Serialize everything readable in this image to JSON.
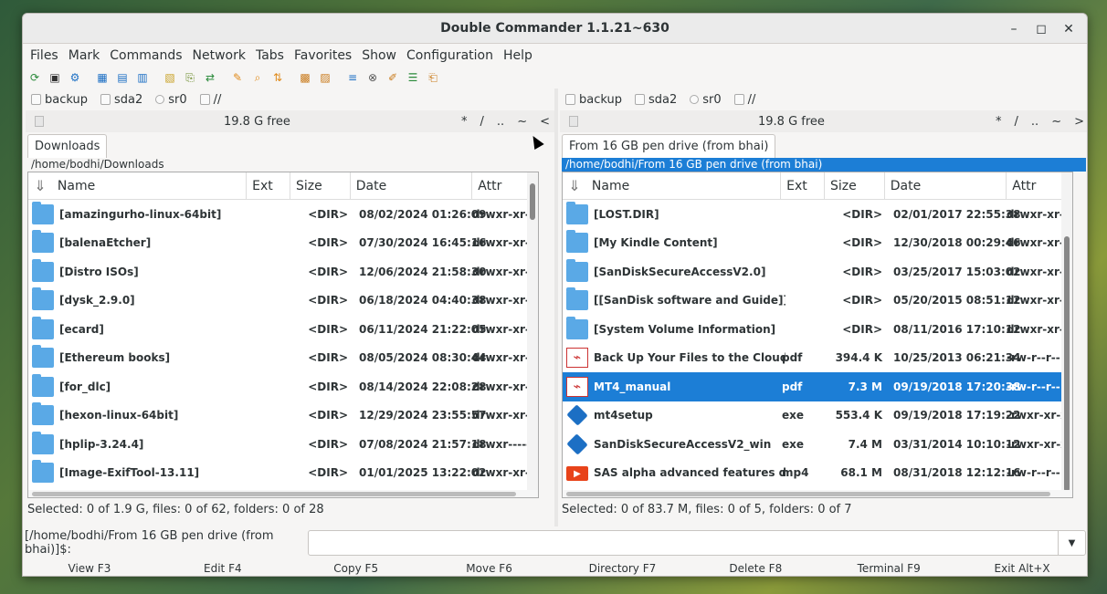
{
  "window": {
    "title": "Double Commander 1.1.21~630"
  },
  "menus": [
    "Files",
    "Mark",
    "Commands",
    "Network",
    "Tabs",
    "Favorites",
    "Show",
    "Configuration",
    "Help"
  ],
  "toolbar_icons": [
    "refresh-icon",
    "terminal-icon",
    "settings-icon",
    "brief-view-icon",
    "full-view-icon",
    "columns-view-icon",
    "thumbnails-view-icon",
    "copy-path-icon",
    "swap-panels-icon",
    "multi-rename-icon",
    "search-icon",
    "sync-dirs-icon",
    "pack-icon",
    "unpack-icon",
    "compare-icon",
    "binoculars-icon",
    "edit-icon",
    "notes-icon",
    "clipboard-icon"
  ],
  "drives": [
    "backup",
    "sda2",
    "sr0",
    "//"
  ],
  "left_panel": {
    "free": "19.8 G free",
    "nav": [
      "*",
      "/",
      "..",
      "~",
      "<"
    ],
    "tab": "Downloads",
    "path": "/home/bodhi/Downloads",
    "columns": [
      "Name",
      "Ext",
      "Size",
      "Date",
      "Attr"
    ],
    "rows": [
      {
        "name": "[amazingurho-linux-64bit]",
        "ext": "",
        "size": "<DIR>",
        "date": "08/02/2024 01:26:09",
        "attr": "drwxr-xr-x",
        "icon": "folder"
      },
      {
        "name": "[balenaEtcher]",
        "ext": "",
        "size": "<DIR>",
        "date": "07/30/2024 16:45:16",
        "attr": "drwxr-xr-x",
        "icon": "folder"
      },
      {
        "name": "[Distro ISOs]",
        "ext": "",
        "size": "<DIR>",
        "date": "12/06/2024 21:58:30",
        "attr": "drwxr-xr-x",
        "icon": "folder"
      },
      {
        "name": "[dysk_2.9.0]",
        "ext": "",
        "size": "<DIR>",
        "date": "06/18/2024 04:40:38",
        "attr": "drwxr-xr-x",
        "icon": "folder"
      },
      {
        "name": "[ecard]",
        "ext": "",
        "size": "<DIR>",
        "date": "06/11/2024 21:22:05",
        "attr": "drwxr-xr-x",
        "icon": "folder"
      },
      {
        "name": "[Ethereum books]",
        "ext": "",
        "size": "<DIR>",
        "date": "08/05/2024 08:30:44",
        "attr": "drwxr-xr-x",
        "icon": "folder"
      },
      {
        "name": "[for_dlc]",
        "ext": "",
        "size": "<DIR>",
        "date": "08/14/2024 22:08:28",
        "attr": "drwxr-xr-x",
        "icon": "folder"
      },
      {
        "name": "[hexon-linux-64bit]",
        "ext": "",
        "size": "<DIR>",
        "date": "12/29/2024 23:55:57",
        "attr": "drwxr-xr-x",
        "icon": "folder"
      },
      {
        "name": "[hplip-3.24.4]",
        "ext": "",
        "size": "<DIR>",
        "date": "07/08/2024 21:57:18",
        "attr": "drwxr-----",
        "icon": "folder"
      },
      {
        "name": "[Image-ExifTool-13.11]",
        "ext": "",
        "size": "<DIR>",
        "date": "01/01/2025 13:22:02",
        "attr": "drwxr-xr-x",
        "icon": "folder"
      }
    ],
    "status": "Selected: 0 of 1.9 G, files: 0 of 62, folders: 0 of 28"
  },
  "right_panel": {
    "free": "19.8 G free",
    "nav": [
      "*",
      "/",
      "..",
      "~",
      ">"
    ],
    "tab": "From 16 GB pen drive (from bhai)",
    "path": "/home/bodhi/From 16 GB pen drive (from bhai)",
    "columns": [
      "Name",
      "Ext",
      "Size",
      "Date",
      "Attr"
    ],
    "rows": [
      {
        "name": "[LOST.DIR]",
        "ext": "",
        "size": "<DIR>",
        "date": "02/01/2017 22:55:38",
        "attr": "drwxr-xr-x",
        "icon": "folder"
      },
      {
        "name": "[My Kindle Content]",
        "ext": "",
        "size": "<DIR>",
        "date": "12/30/2018 00:29:46",
        "attr": "drwxr-xr-x",
        "icon": "folder"
      },
      {
        "name": "[SanDiskSecureAccessV2.0]",
        "ext": "",
        "size": "<DIR>",
        "date": "03/25/2017 15:03:02",
        "attr": "drwxr-xr-x",
        "icon": "folder"
      },
      {
        "name": "[[SanDisk software and Guide]]",
        "ext": "",
        "size": "<DIR>",
        "date": "05/20/2015 08:51:12",
        "attr": "drwxr-xr-x",
        "icon": "folder"
      },
      {
        "name": "[System Volume Information]",
        "ext": "",
        "size": "<DIR>",
        "date": "08/11/2016 17:10:12",
        "attr": "drwxr-xr-x",
        "icon": "folder"
      },
      {
        "name": "Back Up Your Files to the Cloud",
        "ext": "pdf",
        "size": "394.4 K",
        "date": "10/25/2013 06:21:34",
        "attr": "-rw-r--r--",
        "icon": "pdf"
      },
      {
        "name": "MT4_manual",
        "ext": "pdf",
        "size": "7.3 M",
        "date": "09/19/2018 17:20:38",
        "attr": "-rw-r--r--",
        "icon": "pdf",
        "selected": true
      },
      {
        "name": "mt4setup",
        "ext": "exe",
        "size": "553.4 K",
        "date": "09/19/2018 17:19:22",
        "attr": "-rwxr-xr-x",
        "icon": "exe"
      },
      {
        "name": "SanDiskSecureAccessV2_win",
        "ext": "exe",
        "size": "7.4 M",
        "date": "03/31/2014 10:10:12",
        "attr": "-rwxr-xr-x",
        "icon": "exe"
      },
      {
        "name": "SAS alpha advanced features demo",
        "ext": "mp4",
        "size": "68.1 M",
        "date": "08/31/2018 12:12:16",
        "attr": "-rw-r--r--",
        "icon": "mp4"
      }
    ],
    "status": "Selected: 0 of 83.7 M, files: 0 of 5, folders: 0 of 7"
  },
  "command_line": {
    "prompt": "[/home/bodhi/From 16 GB pen drive (from bhai)]$:",
    "value": ""
  },
  "function_keys": [
    "View F3",
    "Edit F4",
    "Copy F5",
    "Move F6",
    "Directory F7",
    "Delete F8",
    "Terminal F9",
    "Exit Alt+X"
  ]
}
